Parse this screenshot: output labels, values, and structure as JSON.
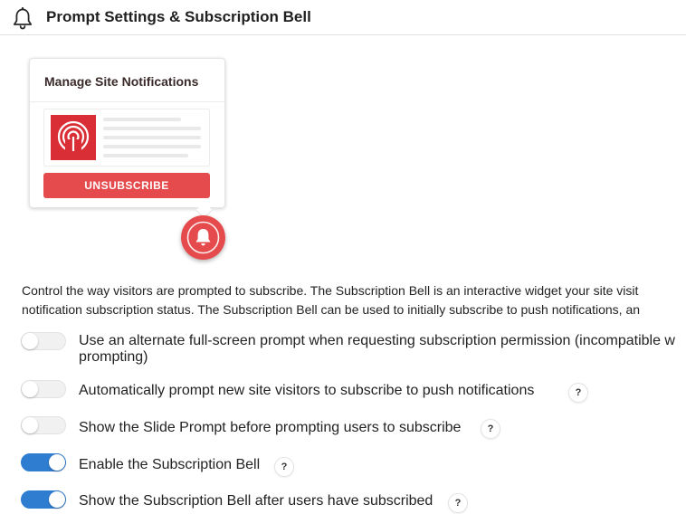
{
  "header": {
    "title": "Prompt Settings & Subscription Bell",
    "icon": "bell-icon"
  },
  "preview": {
    "card_title": "Manage Site Notifications",
    "unsubscribe_label": "UNSUBSCRIBE",
    "site_icon": "broadcast-icon",
    "bell_icon": "bell-icon",
    "accent_color": "#e54b4d"
  },
  "description": {
    "line1": "Control the way visitors are prompted to subscribe. The Subscription Bell is an interactive widget your site visit",
    "line2": "notification subscription status. The Subscription Bell can be used to initially subscribe to push notifications, an"
  },
  "settings": [
    {
      "label_line1": "Use an alternate full-screen prompt when requesting subscription permission (incompatible w",
      "label_line2": "prompting)",
      "enabled": false,
      "has_help": false
    },
    {
      "label": "Automatically prompt new site visitors to subscribe to push notifications",
      "enabled": false,
      "has_help": true,
      "help_label": "?"
    },
    {
      "label": "Show the Slide Prompt before prompting users to subscribe",
      "enabled": false,
      "has_help": true,
      "help_label": "?"
    },
    {
      "label": "Enable the Subscription Bell",
      "enabled": true,
      "has_help": true,
      "help_label": "?"
    },
    {
      "label": "Show the Subscription Bell after users have subscribed",
      "enabled": true,
      "has_help": true,
      "help_label": "?"
    }
  ],
  "colors": {
    "toggle_on": "#2f7dd1",
    "toggle_off": "#f1f1f1"
  }
}
